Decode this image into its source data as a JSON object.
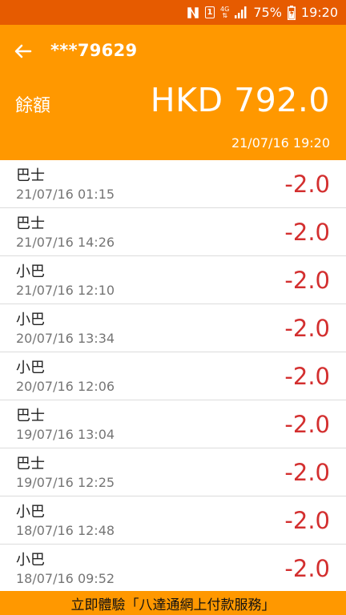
{
  "status_bar": {
    "nfc_icon": "nfc-icon",
    "sim_label": "1",
    "network_label": "4G",
    "signal_icon": "signal-icon",
    "battery_percent": "75%",
    "battery_icon": "battery-charging-icon",
    "time": "19:20"
  },
  "header": {
    "back_icon": "arrow-left-icon",
    "account": "***79629",
    "balance_label": "餘額",
    "balance_value": "HKD 792.0",
    "updated_at": "21/07/16 19:20"
  },
  "transactions": [
    {
      "type": "巴士",
      "datetime": "21/07/16 01:15",
      "amount": "-2.0"
    },
    {
      "type": "巴士",
      "datetime": "21/07/16 14:26",
      "amount": "-2.0"
    },
    {
      "type": "小巴",
      "datetime": "21/07/16 12:10",
      "amount": "-2.0"
    },
    {
      "type": "小巴",
      "datetime": "20/07/16 13:34",
      "amount": "-2.0"
    },
    {
      "type": "小巴",
      "datetime": "20/07/16 12:06",
      "amount": "-2.0"
    },
    {
      "type": "巴士",
      "datetime": "19/07/16 13:04",
      "amount": "-2.0"
    },
    {
      "type": "巴士",
      "datetime": "19/07/16 12:25",
      "amount": "-2.0"
    },
    {
      "type": "小巴",
      "datetime": "18/07/16 12:48",
      "amount": "-2.0"
    },
    {
      "type": "小巴",
      "datetime": "18/07/16 09:52",
      "amount": "-2.0"
    }
  ],
  "promo": {
    "text": "立即體驗「八達通網上付款服務」"
  },
  "colors": {
    "status_bar": "#e65b00",
    "header": "#ff9800",
    "amount": "#d32f2f",
    "promo": "#ff9800"
  }
}
